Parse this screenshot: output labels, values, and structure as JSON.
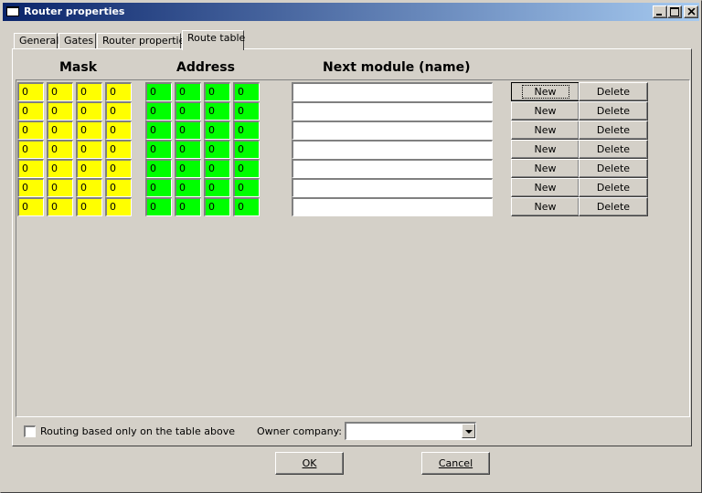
{
  "window": {
    "title": "Router properties"
  },
  "tabs": [
    {
      "label": "General"
    },
    {
      "label": "Gates"
    },
    {
      "label": "Router properties"
    },
    {
      "label": "Route table",
      "active": true
    }
  ],
  "headers": {
    "mask": "Mask",
    "address": "Address",
    "next_module": "Next module (name)"
  },
  "routes": [
    {
      "mask": [
        "0",
        "0",
        "0",
        "0"
      ],
      "address": [
        "0",
        "0",
        "0",
        "0"
      ],
      "next_module": "",
      "new_label": "New",
      "delete_label": "Delete"
    },
    {
      "mask": [
        "0",
        "0",
        "0",
        "0"
      ],
      "address": [
        "0",
        "0",
        "0",
        "0"
      ],
      "next_module": "",
      "new_label": "New",
      "delete_label": "Delete"
    },
    {
      "mask": [
        "0",
        "0",
        "0",
        "0"
      ],
      "address": [
        "0",
        "0",
        "0",
        "0"
      ],
      "next_module": "",
      "new_label": "New",
      "delete_label": "Delete"
    },
    {
      "mask": [
        "0",
        "0",
        "0",
        "0"
      ],
      "address": [
        "0",
        "0",
        "0",
        "0"
      ],
      "next_module": "",
      "new_label": "New",
      "delete_label": "Delete"
    },
    {
      "mask": [
        "0",
        "0",
        "0",
        "0"
      ],
      "address": [
        "0",
        "0",
        "0",
        "0"
      ],
      "next_module": "",
      "new_label": "New",
      "delete_label": "Delete"
    },
    {
      "mask": [
        "0",
        "0",
        "0",
        "0"
      ],
      "address": [
        "0",
        "0",
        "0",
        "0"
      ],
      "next_module": "",
      "new_label": "New",
      "delete_label": "Delete"
    },
    {
      "mask": [
        "0",
        "0",
        "0",
        "0"
      ],
      "address": [
        "0",
        "0",
        "0",
        "0"
      ],
      "next_module": "",
      "new_label": "New",
      "delete_label": "Delete"
    }
  ],
  "routing_only_label": "Routing based only on the table above",
  "routing_only_checked": false,
  "owner_company": {
    "label": "Owner company:",
    "value": ""
  },
  "buttons": {
    "ok": "OK",
    "cancel": "Cancel"
  },
  "colors": {
    "mask_bg": "#ffff00",
    "address_bg": "#00ff00",
    "titlebar_start": "#0a246a",
    "titlebar_end": "#a6caf0"
  }
}
